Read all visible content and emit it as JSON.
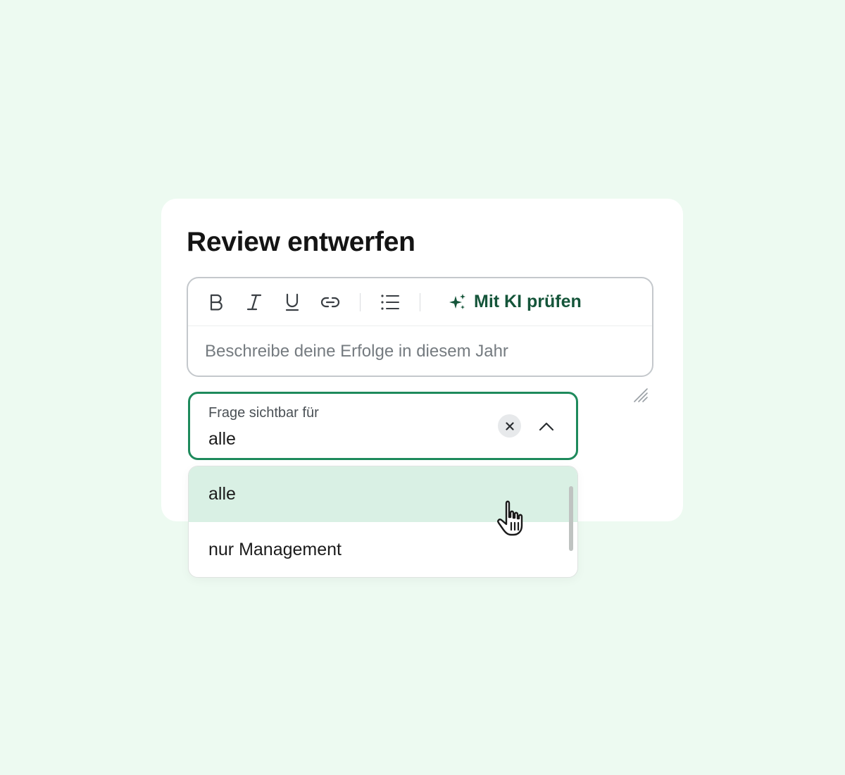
{
  "card": {
    "title": "Review entwerfen"
  },
  "editor": {
    "toolbar": {
      "bold_icon": "bold-icon",
      "italic_icon": "italic-icon",
      "underline_icon": "underline-icon",
      "link_icon": "link-icon",
      "list_icon": "bulleted-list-icon",
      "ai_icon": "sparkle-icon",
      "ai_label": "Mit KI prüfen"
    },
    "placeholder": "Beschreibe deine Erfolge in diesem Jahr"
  },
  "visibility_select": {
    "label": "Frage sichtbar für",
    "value": "alle",
    "clear_icon": "close-icon",
    "toggle_icon": "chevron-up-icon"
  },
  "dropdown": {
    "options": [
      {
        "label": "alle",
        "selected": true
      },
      {
        "label": "nur Management",
        "selected": false
      }
    ]
  },
  "colors": {
    "background": "#edfaf1",
    "accent": "#1e8a5c",
    "ai_text": "#15553a",
    "selected_option": "#d9f0e4"
  }
}
